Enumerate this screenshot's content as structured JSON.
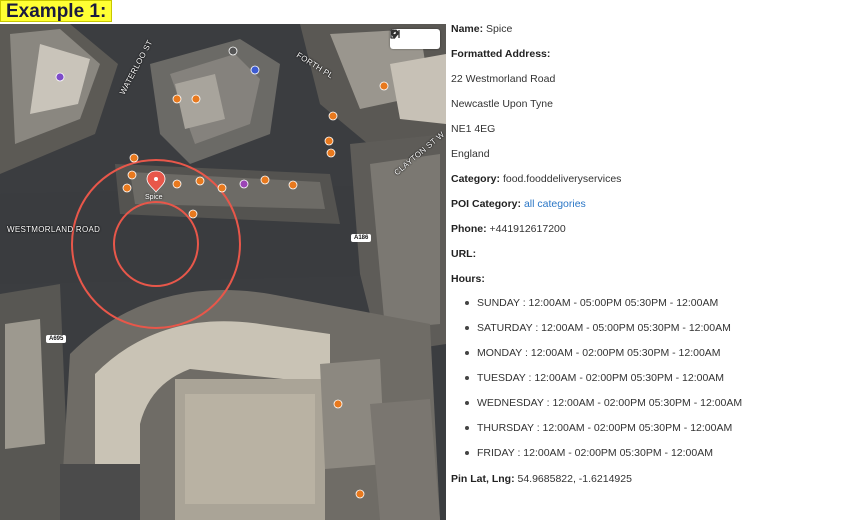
{
  "banner": {
    "title": "Example 1:"
  },
  "map": {
    "roads": {
      "waterloo": "WATERLOO ST",
      "forth": "FORTH PL",
      "clayton": "CLAYTON ST W",
      "westmorland": "WESTMORLAND ROAD",
      "shield_a186": "A186",
      "shield_a695": "A695"
    },
    "pin_label": "Spice",
    "tools": [
      "pin-icon",
      "eraser-icon",
      "bracket-icon"
    ],
    "colors": {
      "circle": "#e8574a",
      "pin": "#e8574a",
      "poi": "#e8791e"
    }
  },
  "details": {
    "name_label": "Name:",
    "name_value": "Spice",
    "address_label": "Formatted Address:",
    "address_lines": [
      "22 Westmorland Road",
      "Newcastle Upon Tyne",
      "NE1 4EG",
      "England"
    ],
    "category_label": "Category:",
    "category_value": "food.fooddeliveryservices",
    "poi_category_label": "POI Category:",
    "poi_category_value": "all categories",
    "phone_label": "Phone:",
    "phone_value": "+441912617200",
    "url_label": "URL:",
    "hours_label": "Hours:",
    "hours": [
      "SUNDAY : 12:00AM - 05:00PM 05:30PM - 12:00AM",
      "SATURDAY : 12:00AM - 05:00PM 05:30PM - 12:00AM",
      "MONDAY : 12:00AM - 02:00PM 05:30PM - 12:00AM",
      "TUESDAY : 12:00AM - 02:00PM 05:30PM - 12:00AM",
      "WEDNESDAY : 12:00AM - 02:00PM 05:30PM - 12:00AM",
      "THURSDAY : 12:00AM - 02:00PM 05:30PM - 12:00AM",
      "FRIDAY : 12:00AM - 02:00PM 05:30PM - 12:00AM"
    ],
    "latlng_label": "Pin Lat, Lng:",
    "latlng_value": "54.9685822, -1.6214925"
  }
}
